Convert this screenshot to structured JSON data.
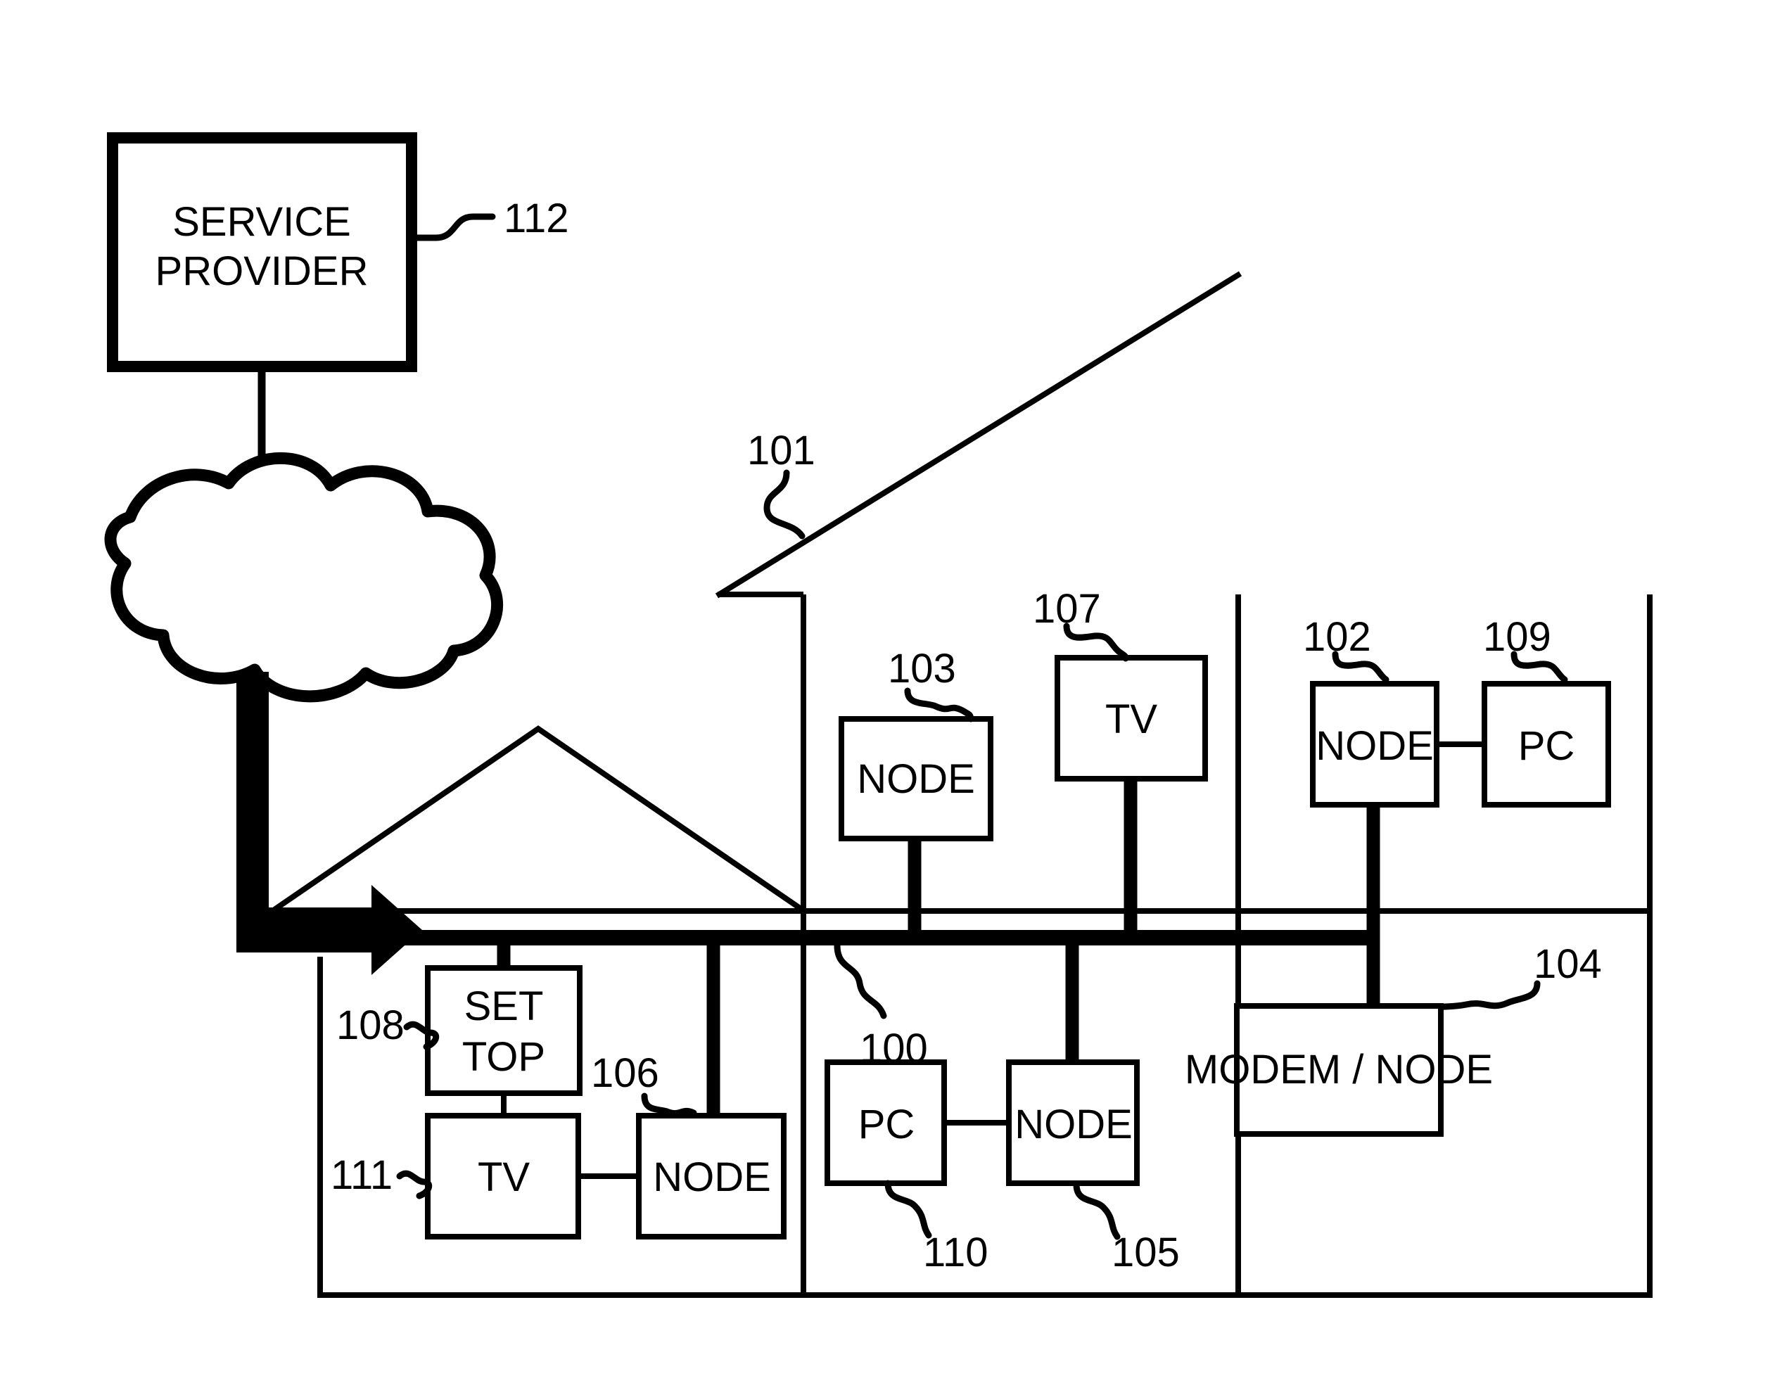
{
  "figure": {
    "title": "Home network distribution diagram",
    "background_color": "#ffffff",
    "line_color": "#000000"
  },
  "boxes": {
    "service_provider": {
      "label_line1": "SERVICE",
      "label_line2": "PROVIDER"
    },
    "node_103": {
      "label": "NODE"
    },
    "tv_107": {
      "label": "TV"
    },
    "node_102": {
      "label": "NODE"
    },
    "pc_109": {
      "label": "PC"
    },
    "set_top_108": {
      "label_line1": "SET",
      "label_line2": "TOP"
    },
    "tv_111": {
      "label": "TV"
    },
    "node_106": {
      "label": "NODE"
    },
    "pc_110": {
      "label": "PC"
    },
    "node_105": {
      "label": "NODE"
    },
    "modem_node_104": {
      "label": "MODEM / NODE"
    }
  },
  "reference_numerals": {
    "n100": "100",
    "n101": "101",
    "n102": "102",
    "n103": "103",
    "n104": "104",
    "n105": "105",
    "n106": "106",
    "n107": "107",
    "n108": "108",
    "n109": "109",
    "n110": "110",
    "n111": "111",
    "n112": "112"
  },
  "elements": {
    "cloud": "network-cloud",
    "house_roof": "house-roof-triangle",
    "premises_roof_line": "premises-roof-diagonal",
    "backbone": "coax-backbone-bus",
    "feed_arrow": "service-feed-arrow"
  }
}
